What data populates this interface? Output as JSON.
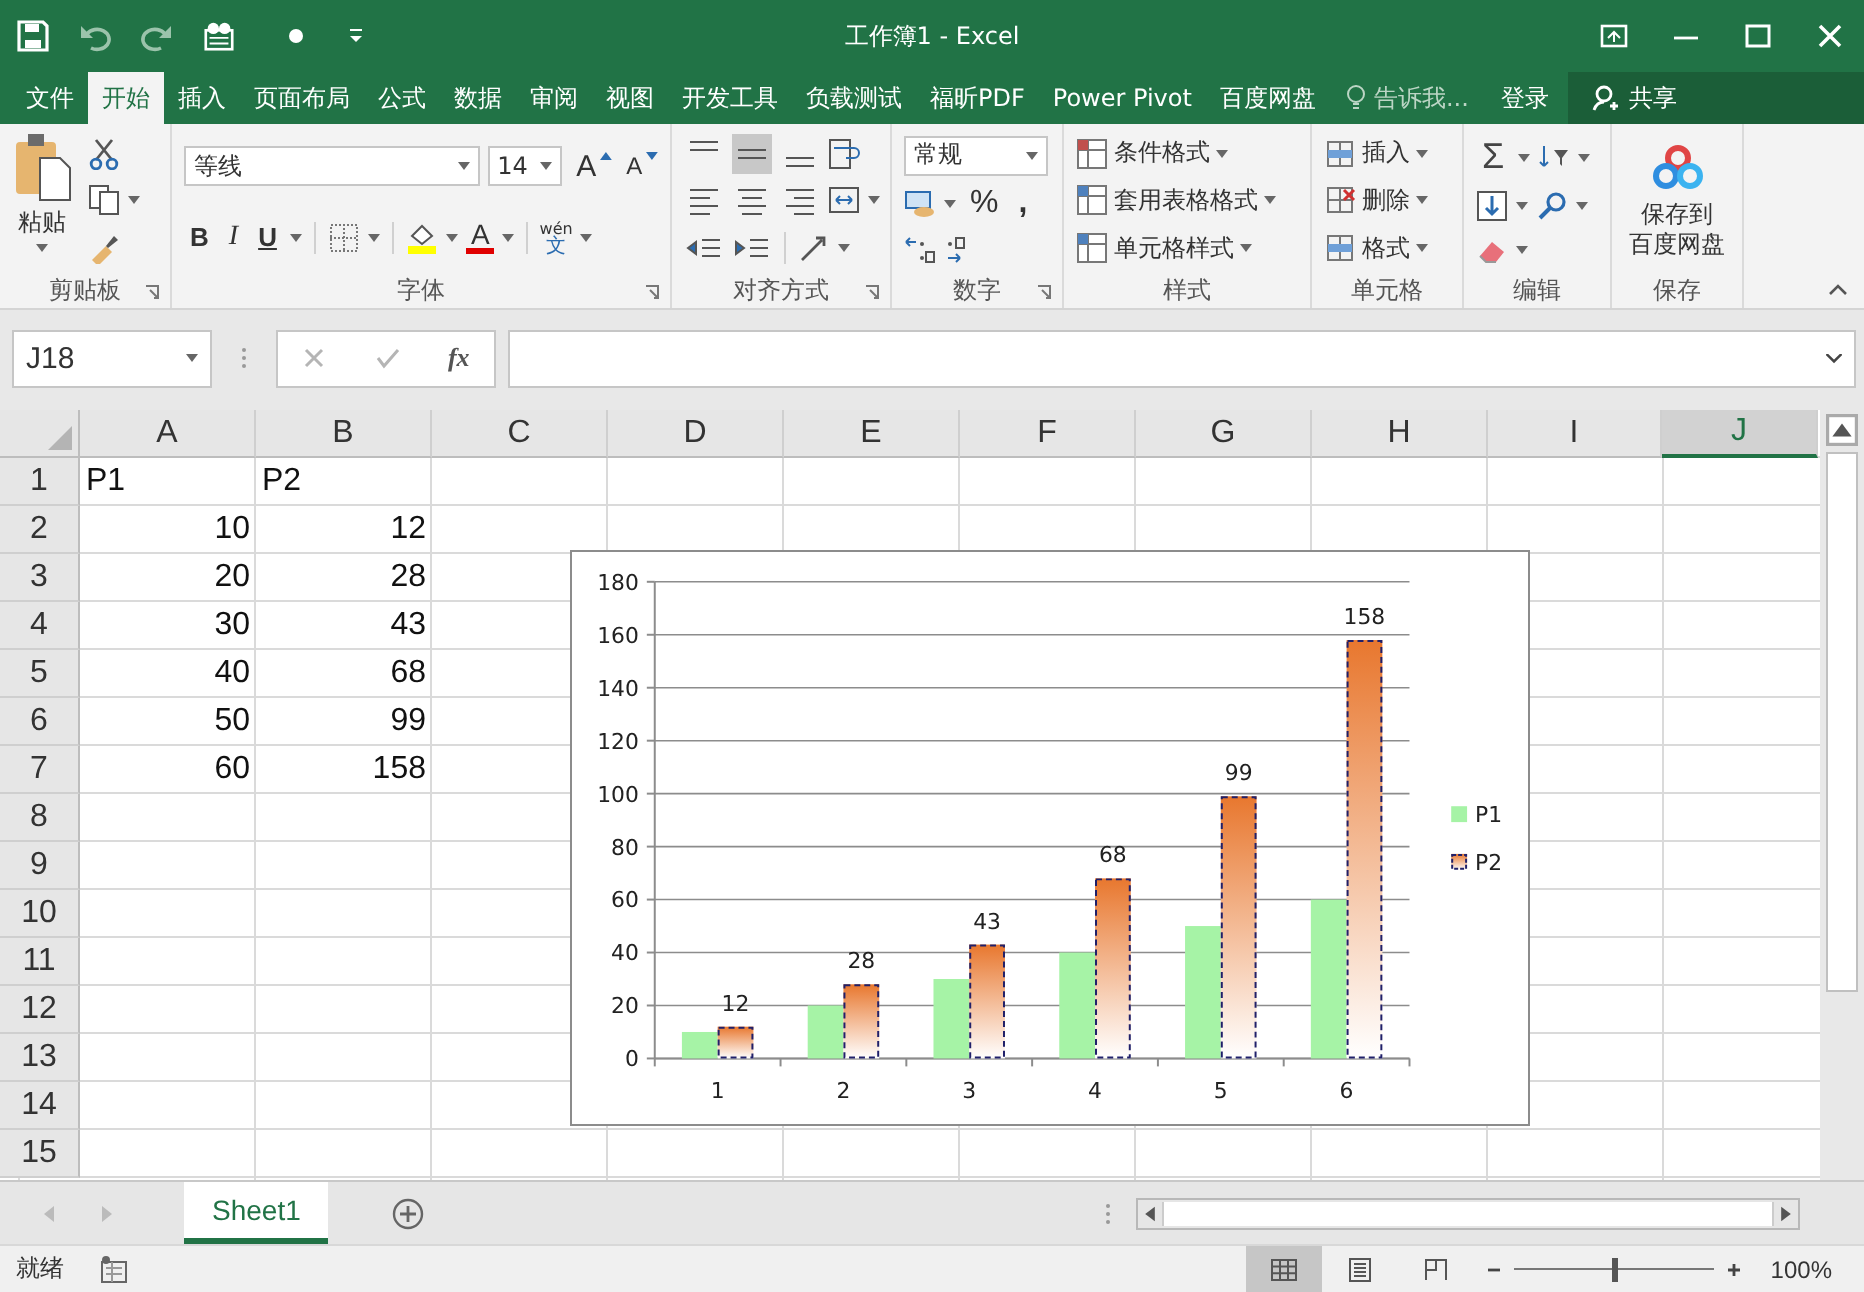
{
  "window": {
    "title": "工作簿1 - Excel"
  },
  "menu_tabs": [
    {
      "label": "文件",
      "selected": false
    },
    {
      "label": "开始",
      "selected": true
    },
    {
      "label": "插入",
      "selected": false
    },
    {
      "label": "页面布局",
      "selected": false
    },
    {
      "label": "公式",
      "selected": false
    },
    {
      "label": "数据",
      "selected": false
    },
    {
      "label": "审阅",
      "selected": false
    },
    {
      "label": "视图",
      "selected": false
    },
    {
      "label": "开发工具",
      "selected": false
    },
    {
      "label": "负载测试",
      "selected": false
    },
    {
      "label": "福昕PDF",
      "selected": false
    },
    {
      "label": "Power Pivot",
      "selected": false
    },
    {
      "label": "百度网盘",
      "selected": false
    }
  ],
  "tell_me": "告诉我...",
  "sign_in": "登录",
  "share": "共享",
  "ribbon": {
    "clipboard": {
      "paste": "粘贴",
      "label": "剪贴板"
    },
    "font": {
      "name": "等线",
      "size": "14",
      "grow": "A",
      "shrink": "A",
      "bold": "B",
      "italic": "I",
      "underline": "U",
      "font_color": "A",
      "phonetic_top": "wén",
      "phonetic_bottom": "文",
      "label": "字体"
    },
    "alignment": {
      "vertical": [
        {
          "selected": false
        },
        {
          "selected": true
        },
        {
          "selected": false
        }
      ],
      "label": "对齐方式"
    },
    "number": {
      "format": "常规",
      "percent": "%",
      "comma": ",",
      "label": "数字"
    },
    "styles": {
      "items": [
        "条件格式",
        "套用表格格式",
        "单元格样式"
      ],
      "label": "样式"
    },
    "cells": {
      "items": [
        "插入",
        "删除",
        "格式"
      ],
      "label": "单元格"
    },
    "editing": {
      "sum": "Σ",
      "label": "编辑"
    },
    "save": {
      "lines": [
        "保存到",
        "百度网盘"
      ],
      "label": "保存"
    }
  },
  "name_box": "J18",
  "fx": "fx",
  "sheet": {
    "columns": [
      {
        "label": "A",
        "selected": false
      },
      {
        "label": "B",
        "selected": false
      },
      {
        "label": "C",
        "selected": false
      },
      {
        "label": "D",
        "selected": false
      },
      {
        "label": "E",
        "selected": false
      },
      {
        "label": "F",
        "selected": false
      },
      {
        "label": "G",
        "selected": false
      },
      {
        "label": "H",
        "selected": false
      },
      {
        "label": "I",
        "selected": false
      },
      {
        "label": "J",
        "selected": true
      }
    ],
    "rows": [
      {
        "number": "1",
        "cells": [
          {
            "text": "P1",
            "kind": "text"
          },
          {
            "text": "P2",
            "kind": "text"
          }
        ]
      },
      {
        "number": "2",
        "cells": [
          {
            "text": "10",
            "kind": "number"
          },
          {
            "text": "12",
            "kind": "number"
          }
        ]
      },
      {
        "number": "3",
        "cells": [
          {
            "text": "20",
            "kind": "number"
          },
          {
            "text": "28",
            "kind": "number"
          }
        ]
      },
      {
        "number": "4",
        "cells": [
          {
            "text": "30",
            "kind": "number"
          },
          {
            "text": "43",
            "kind": "number"
          }
        ]
      },
      {
        "number": "5",
        "cells": [
          {
            "text": "40",
            "kind": "number"
          },
          {
            "text": "68",
            "kind": "number"
          }
        ]
      },
      {
        "number": "6",
        "cells": [
          {
            "text": "50",
            "kind": "number"
          },
          {
            "text": "99",
            "kind": "number"
          }
        ]
      },
      {
        "number": "7",
        "cells": [
          {
            "text": "60",
            "kind": "number"
          },
          {
            "text": "158",
            "kind": "number"
          }
        ]
      },
      {
        "number": "8"
      },
      {
        "number": "9"
      },
      {
        "number": "10"
      },
      {
        "number": "11"
      },
      {
        "number": "12"
      },
      {
        "number": "13"
      },
      {
        "number": "14"
      },
      {
        "number": "15"
      }
    ]
  },
  "chart": {
    "chart_data": {
      "type": "bar",
      "categories": [
        "1",
        "2",
        "3",
        "4",
        "5",
        "6"
      ],
      "series": [
        {
          "name": "P1",
          "color": "#a6f3a6",
          "values": [
            10,
            20,
            30,
            40,
            50,
            60
          ]
        },
        {
          "name": "P2",
          "color": "#e8772e",
          "values": [
            12,
            28,
            43,
            68,
            99,
            158
          ],
          "value_labels": [
            "12",
            "28",
            "43",
            "68",
            "99",
            "158"
          ]
        }
      ],
      "ylim": [
        0,
        180
      ],
      "yticks": [
        {
          "value": 0,
          "label": "0"
        },
        {
          "value": 20,
          "label": "20"
        },
        {
          "value": 40,
          "label": "40"
        },
        {
          "value": 60,
          "label": "60"
        },
        {
          "value": 80,
          "label": "80"
        },
        {
          "value": 100,
          "label": "100"
        },
        {
          "value": 120,
          "label": "120"
        },
        {
          "value": 140,
          "label": "140"
        },
        {
          "value": 160,
          "label": "160"
        },
        {
          "value": 180,
          "label": "180"
        }
      ],
      "grid": true,
      "legend": true
    }
  },
  "sheet_tabs": [
    {
      "label": "Sheet1",
      "selected": true
    }
  ],
  "status_bar": {
    "status": "就绪",
    "views": [
      {
        "kind": "normal",
        "selected": true
      },
      {
        "kind": "page_layout",
        "selected": false
      },
      {
        "kind": "page_break",
        "selected": false
      }
    ],
    "zoom": {
      "level": 0.5,
      "reading": "100%"
    }
  }
}
